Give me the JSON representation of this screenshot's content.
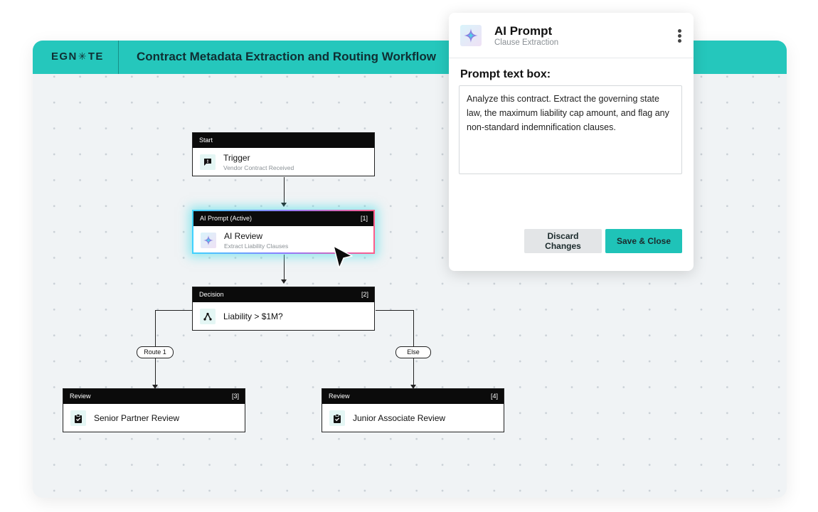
{
  "header": {
    "logo_left": "EGN",
    "logo_star": "✳",
    "logo_right": "TE",
    "workflow_title": "Contract Metadata Extraction and Routing Workflow"
  },
  "nodes": {
    "start": {
      "head": "Start",
      "number": "",
      "title": "Trigger",
      "subtitle": "Vendor Contract Received",
      "icon": "message-alert-icon"
    },
    "ai": {
      "head": "AI Prompt (Active)",
      "number": "[1]",
      "title": "AI Review",
      "subtitle": "Extract Liability Clauses",
      "icon": "sparkle-icon"
    },
    "decision": {
      "head": "Decision",
      "number": "[2]",
      "title": "Liability > $1M?",
      "icon": "branch-icon"
    },
    "review_senior": {
      "head": "Review",
      "number": "[3]",
      "title": "Senior Partner Review",
      "icon": "clipboard-check-icon"
    },
    "review_junior": {
      "head": "Review",
      "number": "[4]",
      "title": "Junior Associate Review",
      "icon": "clipboard-check-icon"
    }
  },
  "routes": {
    "left": "Route 1",
    "right": "Else"
  },
  "panel": {
    "title": "AI Prompt",
    "subtitle": "Clause Extraction",
    "prompt_label": "Prompt text box:",
    "prompt_text": "Analyze this contract. Extract the governing state law, the maximum liability cap amount, and flag any non-standard indemnification clauses.",
    "discard_label": "Discard Changes",
    "save_label": "Save & Close",
    "icon": "sparkle-icon",
    "menu_icon": "kebab-menu-icon"
  },
  "colors": {
    "accent": "#25c7bc",
    "button_primary": "#1fc3b8",
    "node_header": "#0b0b0b"
  }
}
